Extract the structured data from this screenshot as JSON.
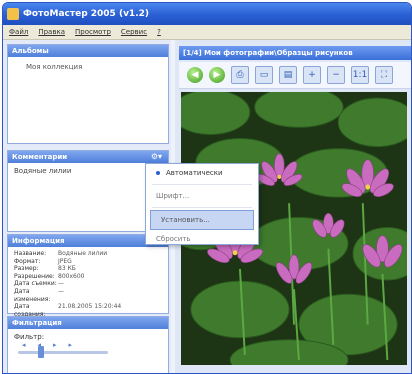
{
  "window": {
    "title": "ФотоМастер 2005 (v1.2)"
  },
  "menu": [
    "Файл",
    "Правка",
    "Просмотр",
    "Сервис",
    "?"
  ],
  "albums": {
    "header": "Альбомы",
    "items": [
      "Моя коллекция"
    ]
  },
  "comments": {
    "header": "Комментарии",
    "text": "Водяные лилии",
    "tool_icon": "gear-icon"
  },
  "dropdown": {
    "items": [
      {
        "label": "Автоматически",
        "checked": true
      },
      {
        "label": "Шрифт...",
        "checked": false
      },
      {
        "label": "Установить...",
        "checked": false,
        "highlighted": true
      },
      {
        "label": "Сбросить",
        "checked": false
      }
    ]
  },
  "info": {
    "header": "Информация",
    "rows": [
      {
        "k": "Название:",
        "v": "Водяные лилии"
      },
      {
        "k": "Формат:",
        "v": "JPEG"
      },
      {
        "k": "Размер:",
        "v": "83 КБ"
      },
      {
        "k": "Разрешение:",
        "v": "800x600"
      },
      {
        "k": "Дата съемки:",
        "v": "—"
      },
      {
        "k": "Дата изменения:",
        "v": "—"
      },
      {
        "k": "Дата создания:",
        "v": "21.08.2005 15:20:44"
      }
    ]
  },
  "filter": {
    "header": "Фильтрация",
    "label": "Фильтр:"
  },
  "viewer": {
    "header": "[1/4]   Мои фотографии\\Образцы рисунков"
  },
  "toolbar": {
    "buttons": [
      {
        "name": "back-button",
        "glyph": "◀",
        "kind": "round"
      },
      {
        "name": "forward-button",
        "glyph": "▶",
        "kind": "round"
      },
      {
        "name": "print-button",
        "glyph": "⎙",
        "kind": "sq"
      },
      {
        "name": "fit-button",
        "glyph": "▭",
        "kind": "sq"
      },
      {
        "name": "slideshow-button",
        "glyph": "▤",
        "kind": "sq"
      },
      {
        "name": "zoom-in-button",
        "glyph": "+",
        "kind": "sq"
      },
      {
        "name": "zoom-out-button",
        "glyph": "−",
        "kind": "sq"
      },
      {
        "name": "actual-size-button",
        "glyph": "1:1",
        "kind": "sq"
      },
      {
        "name": "fullscreen-button",
        "glyph": "⛶",
        "kind": "sq"
      }
    ]
  },
  "colors": {
    "accent": "#2a5fd4",
    "panel_header": "#4f7fda",
    "leaf_green": "#3f7a2d",
    "flower_pink": "#c96bbf"
  }
}
